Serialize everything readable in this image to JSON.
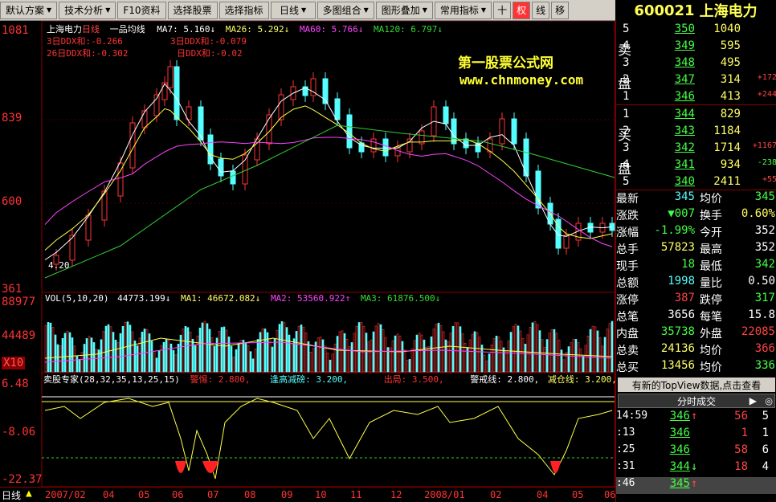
{
  "toolbar": {
    "items": [
      "默认方案",
      "技术分析",
      "F10资料",
      "选择股票",
      "选择指标",
      "日线",
      "多图组合",
      "图形叠加",
      "常用指标"
    ],
    "icons": [
      "十",
      "权",
      "线",
      "移"
    ]
  },
  "stock": {
    "code": "600021",
    "name": "上海电力"
  },
  "chart": {
    "title": "上海电力",
    "period": "日线",
    "indicator": "一品均线",
    "ma_labels": [
      "MA7: 5.160↓",
      "MA26: 5.292↓",
      "MA60: 5.766↓",
      "MA120: 6.797↓"
    ],
    "ddx_lines": [
      "3日DDX和:-0.266",
      "26日DDX和:-0.302",
      "3日DDX和:-0.079",
      "日DDX和:-0.02"
    ],
    "watermark_title": "第一股票公式网",
    "watermark_url": "www.chnmoney.com",
    "price_axis": [
      "1081",
      "839",
      "600",
      "361"
    ],
    "low_marker": "4.20",
    "vol_label": "VOL(5,10,20)",
    "vol_values": [
      "44773.199↓",
      "MA1: 46672.082↓",
      "MA2: 53560.922↑",
      "MA3: 61876.500↓"
    ],
    "vol_axis": [
      "88977",
      "44489",
      "X10"
    ],
    "ind_label": "卖股专家(28,32,35,13,25,15)",
    "ind_values": [
      "警惕: 2.800,",
      "逢高减磅: 3.200,",
      "出局: 3.500,",
      "警戒线: 2.800,",
      "减仓线: 3.200,"
    ],
    "ind_axis": [
      "6.48",
      "-8.06",
      "-22.37"
    ]
  },
  "bottom": {
    "period": "日线",
    "months": [
      "2007/02",
      "04",
      "05",
      "06",
      "07",
      "08",
      "09",
      "10",
      "11",
      "12",
      "2008/01",
      "02",
      "04",
      "05",
      "06"
    ]
  },
  "orderbook": {
    "sell_label": [
      "卖",
      "盘"
    ],
    "buy_label": [
      "买",
      "盘"
    ],
    "sells": [
      {
        "lv": "5",
        "price": "350",
        "vol": "1040",
        "chg": ""
      },
      {
        "lv": "4",
        "price": "349",
        "vol": "595",
        "chg": ""
      },
      {
        "lv": "3",
        "price": "348",
        "vol": "495",
        "chg": ""
      },
      {
        "lv": "2",
        "price": "347",
        "vol": "314",
        "chg": "+172"
      },
      {
        "lv": "1",
        "price": "346",
        "vol": "413",
        "chg": "+244"
      }
    ],
    "buys": [
      {
        "lv": "1",
        "price": "344",
        "vol": "829",
        "chg": ""
      },
      {
        "lv": "2",
        "price": "343",
        "vol": "1184",
        "chg": ""
      },
      {
        "lv": "3",
        "price": "342",
        "vol": "1714",
        "chg": "+1167"
      },
      {
        "lv": "4",
        "price": "341",
        "vol": "934",
        "chg": "-238"
      },
      {
        "lv": "5",
        "price": "340",
        "vol": "2411",
        "chg": "+55"
      }
    ]
  },
  "quote": [
    {
      "l": "最新",
      "v": "345",
      "vc": "c",
      "l2": "均价",
      "v2": "345",
      "v2c": "g"
    },
    {
      "l": "涨跌",
      "v": "▼007",
      "vc": "g",
      "l2": "换手",
      "v2": "0.60%",
      "v2c": "y"
    },
    {
      "l": "涨幅",
      "v": "-1.99%",
      "vc": "g",
      "l2": "今开",
      "v2": "352",
      "v2c": "w"
    },
    {
      "l": "总手",
      "v": "57823",
      "vc": "y",
      "l2": "最高",
      "v2": "352",
      "v2c": "w"
    },
    {
      "l": "现手",
      "v": "18",
      "vc": "g",
      "l2": "最低",
      "v2": "342",
      "v2c": "g"
    },
    {
      "l": "总额",
      "v": "1998",
      "vc": "c",
      "l2": "量比",
      "v2": "0.50",
      "v2c": "w"
    },
    {
      "l": "涨停",
      "v": "387",
      "vc": "r",
      "l2": "跌停",
      "v2": "317",
      "v2c": "g"
    },
    {
      "l": "总笔",
      "v": "3656",
      "vc": "w",
      "l2": "每笔",
      "v2": "15.8",
      "v2c": "w"
    },
    {
      "l": "内盘",
      "v": "35738",
      "vc": "g",
      "l2": "外盘",
      "v2": "22085",
      "v2c": "r"
    },
    {
      "l": "总卖",
      "v": "24136",
      "vc": "y",
      "l2": "均价",
      "v2": "366",
      "v2c": "r"
    },
    {
      "l": "总买",
      "v": "13456",
      "vc": "y",
      "l2": "均价",
      "v2": "336",
      "v2c": "g"
    }
  ],
  "topview": "有新的TopView数据,点击查看",
  "ticks_header": "分时成交",
  "ticks": [
    {
      "t": "14:59",
      "p": "346",
      "arrow": "↑",
      "v": "56",
      "vc": "r",
      "n": "5"
    },
    {
      "t": ":13",
      "p": "346",
      "arrow": "",
      "v": "1",
      "vc": "r",
      "n": "1"
    },
    {
      "t": ":25",
      "p": "346",
      "arrow": "",
      "v": "58",
      "vc": "r",
      "n": "6"
    },
    {
      "t": ":31",
      "p": "344",
      "arrow": "↓",
      "v": "18",
      "vc": "r",
      "n": "4"
    },
    {
      "t": ":46",
      "p": "345",
      "arrow": "↑",
      "v": "",
      "vc": "r",
      "n": ""
    }
  ],
  "colors": {
    "up": "#ff3333",
    "down": "#44ff44",
    "ma7": "#ffffff",
    "ma26": "#ffff44",
    "ma60": "#ff44ff",
    "ma120": "#33cc33"
  }
}
